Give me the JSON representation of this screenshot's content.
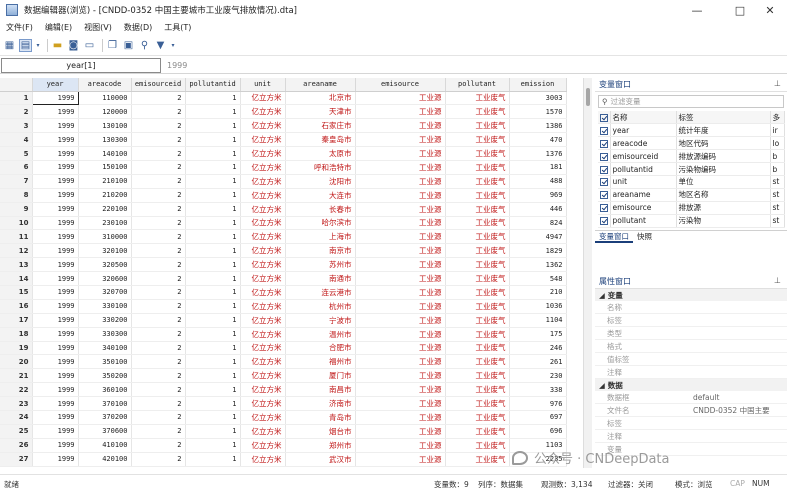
{
  "window": {
    "title": "数据编辑器(浏览) - [CNDD-0352 中国主要城市工业废气排放情况).dta]",
    "minimize": "—",
    "maximize": "□",
    "close": "✕"
  },
  "menu": [
    "文件(F)",
    "编辑(E)",
    "视图(V)",
    "数据(D)",
    "工具(T)"
  ],
  "toolbar_icons": [
    "table-icon",
    "browse-icon",
    "open-icon",
    "save-icon",
    "print-icon",
    "copy-icon",
    "paste-icon",
    "search-icon",
    "filter-icon"
  ],
  "cell_ref": {
    "name": "year[1]",
    "value": "1999"
  },
  "table": {
    "columns": [
      "year",
      "areacode",
      "emisourceid",
      "pollutantid",
      "unit",
      "areaname",
      "emisource",
      "pollutant",
      "emission"
    ],
    "rows": [
      [
        "1",
        "1999",
        "110000",
        "2",
        "1",
        "亿立方米",
        "北京市",
        "工业源",
        "工业废气",
        "3003"
      ],
      [
        "2",
        "1999",
        "120000",
        "2",
        "1",
        "亿立方米",
        "天津市",
        "工业源",
        "工业废气",
        "1570"
      ],
      [
        "3",
        "1999",
        "130100",
        "2",
        "1",
        "亿立方米",
        "石家庄市",
        "工业源",
        "工业废气",
        "1386"
      ],
      [
        "4",
        "1999",
        "130300",
        "2",
        "1",
        "亿立方米",
        "秦皇岛市",
        "工业源",
        "工业废气",
        "470"
      ],
      [
        "5",
        "1999",
        "140100",
        "2",
        "1",
        "亿立方米",
        "太原市",
        "工业源",
        "工业废气",
        "1376"
      ],
      [
        "6",
        "1999",
        "150100",
        "2",
        "1",
        "亿立方米",
        "呼和浩特市",
        "工业源",
        "工业废气",
        "181"
      ],
      [
        "7",
        "1999",
        "210100",
        "2",
        "1",
        "亿立方米",
        "沈阳市",
        "工业源",
        "工业废气",
        "488"
      ],
      [
        "8",
        "1999",
        "210200",
        "2",
        "1",
        "亿立方米",
        "大连市",
        "工业源",
        "工业废气",
        "969"
      ],
      [
        "9",
        "1999",
        "220100",
        "2",
        "1",
        "亿立方米",
        "长春市",
        "工业源",
        "工业废气",
        "446"
      ],
      [
        "10",
        "1999",
        "230100",
        "2",
        "1",
        "亿立方米",
        "哈尔滨市",
        "工业源",
        "工业废气",
        "824"
      ],
      [
        "11",
        "1999",
        "310000",
        "2",
        "1",
        "亿立方米",
        "上海市",
        "工业源",
        "工业废气",
        "4947"
      ],
      [
        "12",
        "1999",
        "320100",
        "2",
        "1",
        "亿立方米",
        "南京市",
        "工业源",
        "工业废气",
        "1829"
      ],
      [
        "13",
        "1999",
        "320500",
        "2",
        "1",
        "亿立方米",
        "苏州市",
        "工业源",
        "工业废气",
        "1362"
      ],
      [
        "14",
        "1999",
        "320600",
        "2",
        "1",
        "亿立方米",
        "南通市",
        "工业源",
        "工业废气",
        "548"
      ],
      [
        "15",
        "1999",
        "320700",
        "2",
        "1",
        "亿立方米",
        "连云港市",
        "工业源",
        "工业废气",
        "210"
      ],
      [
        "16",
        "1999",
        "330100",
        "2",
        "1",
        "亿立方米",
        "杭州市",
        "工业源",
        "工业废气",
        "1036"
      ],
      [
        "17",
        "1999",
        "330200",
        "2",
        "1",
        "亿立方米",
        "宁波市",
        "工业源",
        "工业废气",
        "1104"
      ],
      [
        "18",
        "1999",
        "330300",
        "2",
        "1",
        "亿立方米",
        "温州市",
        "工业源",
        "工业废气",
        "175"
      ],
      [
        "19",
        "1999",
        "340100",
        "2",
        "1",
        "亿立方米",
        "合肥市",
        "工业源",
        "工业废气",
        "246"
      ],
      [
        "20",
        "1999",
        "350100",
        "2",
        "1",
        "亿立方米",
        "福州市",
        "工业源",
        "工业废气",
        "261"
      ],
      [
        "21",
        "1999",
        "350200",
        "2",
        "1",
        "亿立方米",
        "厦门市",
        "工业源",
        "工业废气",
        "230"
      ],
      [
        "22",
        "1999",
        "360100",
        "2",
        "1",
        "亿立方米",
        "南昌市",
        "工业源",
        "工业废气",
        "338"
      ],
      [
        "23",
        "1999",
        "370100",
        "2",
        "1",
        "亿立方米",
        "济南市",
        "工业源",
        "工业废气",
        "976"
      ],
      [
        "24",
        "1999",
        "370200",
        "2",
        "1",
        "亿立方米",
        "青岛市",
        "工业源",
        "工业废气",
        "697"
      ],
      [
        "25",
        "1999",
        "370600",
        "2",
        "1",
        "亿立方米",
        "烟台市",
        "工业源",
        "工业废气",
        "696"
      ],
      [
        "26",
        "1999",
        "410100",
        "2",
        "1",
        "亿立方米",
        "郑州市",
        "工业源",
        "工业废气",
        "1103"
      ],
      [
        "27",
        "1999",
        "420100",
        "2",
        "1",
        "亿立方米",
        "武汉市",
        "工业源",
        "工业废气",
        "2235"
      ]
    ]
  },
  "var_window": {
    "title": "变量窗口",
    "pin": "⊥",
    "filter_placeholder": "过滤变量",
    "head_name": "名称",
    "head_label": "标签",
    "head_type": "多",
    "vars": [
      {
        "name": "year",
        "label": "统计年度",
        "type": "ir"
      },
      {
        "name": "areacode",
        "label": "地区代码",
        "type": "lo"
      },
      {
        "name": "emisourceid",
        "label": "排放源编码",
        "type": "b"
      },
      {
        "name": "pollutantid",
        "label": "污染物编码",
        "type": "b"
      },
      {
        "name": "unit",
        "label": "单位",
        "type": "st"
      },
      {
        "name": "areaname",
        "label": "地区名称",
        "type": "st"
      },
      {
        "name": "emisource",
        "label": "排放源",
        "type": "st"
      },
      {
        "name": "pollutant",
        "label": "污染物",
        "type": "st"
      }
    ],
    "tabs": [
      "变量窗口",
      "快照"
    ]
  },
  "prop_window": {
    "title": "属性窗口",
    "pin": "⊥",
    "sec_var": "变量",
    "var_props": [
      "名称",
      "标签",
      "类型",
      "格式",
      "值标签",
      "注释"
    ],
    "sec_data": "数据",
    "data_props": [
      {
        "k": "数据框",
        "v": "default"
      },
      {
        "k": "文件名",
        "v": "CNDD-0352 中国主要"
      },
      {
        "k": "标签",
        "v": ""
      },
      {
        "k": "注释",
        "v": ""
      },
      {
        "k": "变量",
        "v": ""
      }
    ]
  },
  "status": {
    "ready": "就绪",
    "vars": "变量数：9",
    "order": "列序：数据集",
    "obs": "观测数：3,134",
    "filter": "过滤器：关闭",
    "mode": "模式：浏览",
    "cap": "CAP",
    "num": "NUM"
  },
  "watermark": "公众号 · CNDeepData"
}
